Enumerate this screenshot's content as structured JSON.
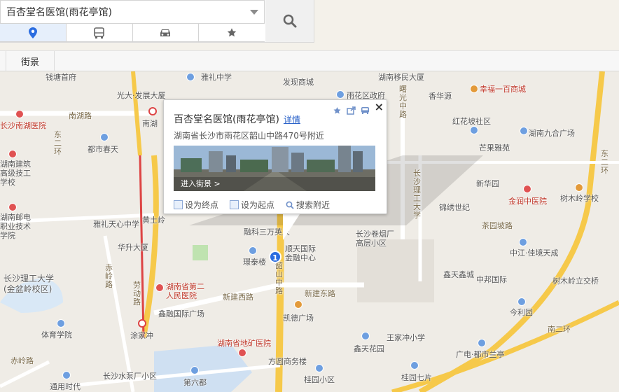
{
  "search": {
    "value": "百杏堂名医馆(雨花亭馆)"
  },
  "modes": [
    "location-icon",
    "bus-icon",
    "car-icon",
    "star-icon"
  ],
  "toolbar": {
    "streetview_label": "街景"
  },
  "popup": {
    "title": "百杏堂名医馆(雨花亭馆)",
    "detail_link": "详情",
    "address": "湖南省长沙市雨花区韶山中路470号附近",
    "photo_label": "进入街景 >",
    "actions": [
      {
        "icon": "destination-icon",
        "label": "设为终点"
      },
      {
        "icon": "origin-icon",
        "label": "设为起点"
      },
      {
        "icon": "search-nearby-icon",
        "label": "搜索附近"
      }
    ],
    "close_label": "×"
  },
  "marker": {
    "label": "1"
  },
  "map_labels": [
    {
      "text": "钱塘首府"
    },
    {
      "text": "雅礼中学"
    },
    {
      "text": "发现商城"
    },
    {
      "text": "湖南移民大厦"
    },
    {
      "text": "光大·发展大厦"
    },
    {
      "text": "雨花区政府"
    },
    {
      "text": "幸福一百商城"
    },
    {
      "text": "香华源"
    },
    {
      "text": "南湖路"
    },
    {
      "text": "南湖"
    },
    {
      "text": "长沙南湖医院"
    },
    {
      "text": "红花坡社区"
    },
    {
      "text": "湖南九合广场"
    },
    {
      "text": "都市春天"
    },
    {
      "text": "芒果雅苑"
    },
    {
      "text": "湖南建筑高级技工学校"
    },
    {
      "text": "新华园"
    },
    {
      "text": "金润中医院"
    },
    {
      "text": "树木岭学校"
    },
    {
      "text": "锦绣世纪"
    },
    {
      "text": "湖南邮电职业技术学院"
    },
    {
      "text": "雅礼天心中学"
    },
    {
      "text": "黄土岭"
    },
    {
      "text": "融科三万英尺"
    },
    {
      "text": "长沙卷烟厂高层小区"
    },
    {
      "text": "茶园坡路"
    },
    {
      "text": "华升大厦"
    },
    {
      "text": "顺天国际金融中心"
    },
    {
      "text": "璟泰楼"
    },
    {
      "text": "中江·佳境天成"
    },
    {
      "text": "长沙理工大学"
    },
    {
      "text": "(金盆岭校区)"
    },
    {
      "text": "鑫天鑫城"
    },
    {
      "text": "中邦国际"
    },
    {
      "text": "树木岭立交桥"
    },
    {
      "text": "湖南省第二人民医院"
    },
    {
      "text": "新建西路"
    },
    {
      "text": "新建东路"
    },
    {
      "text": "鑫融国际广场"
    },
    {
      "text": "今利园"
    },
    {
      "text": "凯德广场"
    },
    {
      "text": "体育学院"
    },
    {
      "text": "涂家冲"
    },
    {
      "text": "王家冲小学"
    },
    {
      "text": "湖南省地矿医院"
    },
    {
      "text": "鑫天花园"
    },
    {
      "text": "广电·都市兰亭"
    },
    {
      "text": "赤岭路"
    },
    {
      "text": "方圆商务楼"
    },
    {
      "text": "长沙水泵厂小区"
    },
    {
      "text": "第六都"
    },
    {
      "text": "桂园小区"
    },
    {
      "text": "桂园七片"
    },
    {
      "text": "通用时代"
    },
    {
      "text": "韶山中路"
    },
    {
      "text": "东二环"
    },
    {
      "text": "南二环"
    },
    {
      "text": "劳动路"
    },
    {
      "text": "赤岭路"
    },
    {
      "text": "曙光中路"
    },
    {
      "text": "东二环"
    },
    {
      "text": "长沙理工大学"
    }
  ],
  "colors": {
    "primary": "#2b6de0",
    "poi_red": "#e05252",
    "road_main": "#f6c94a"
  }
}
